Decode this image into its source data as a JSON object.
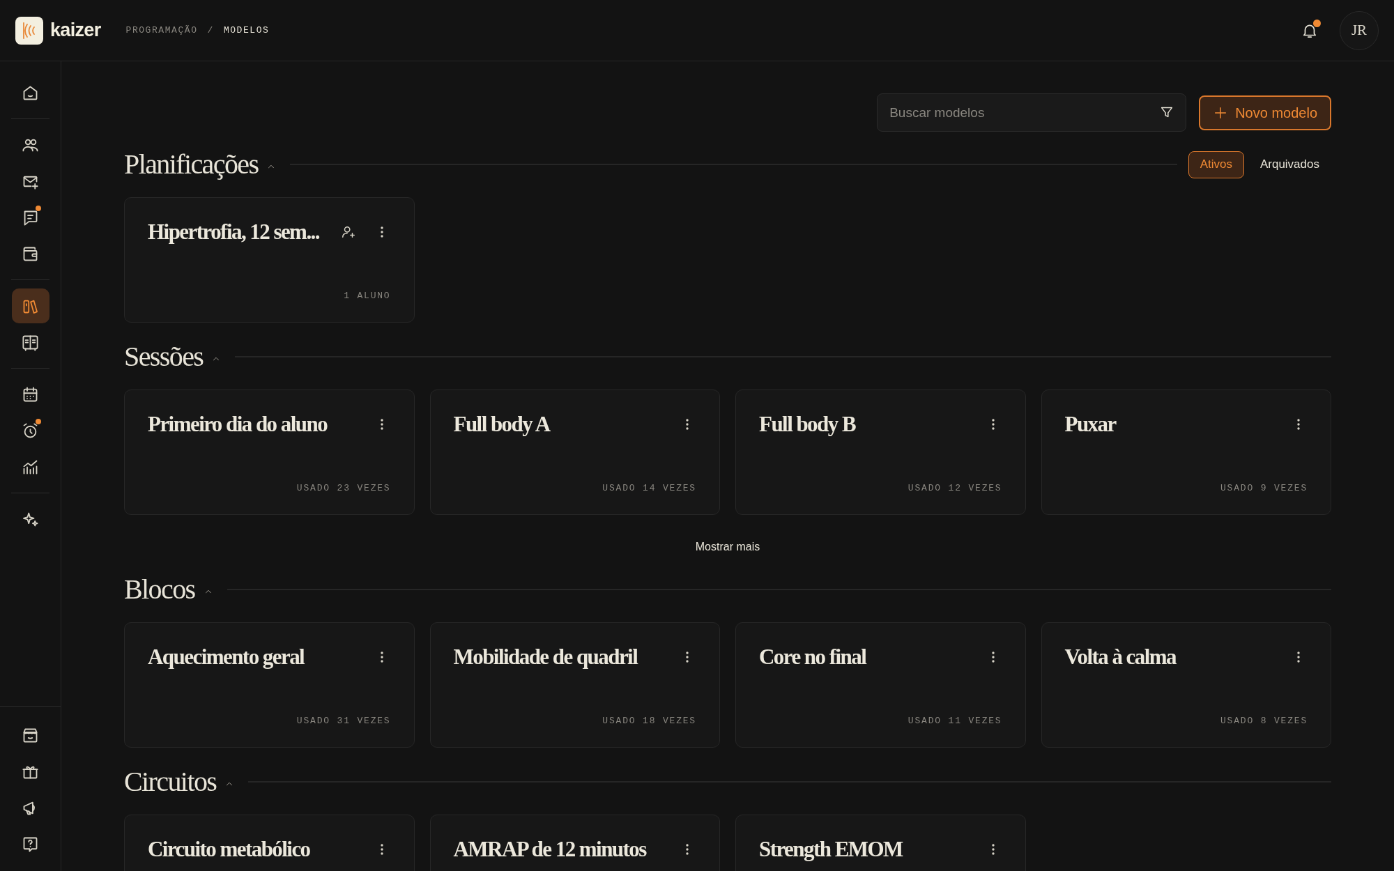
{
  "header": {
    "brand": "kaizer",
    "breadcrumb": [
      {
        "label": "PROGRAMAÇÃO",
        "current": false
      },
      {
        "label": "MODELOS",
        "current": true
      }
    ],
    "breadcrumb_separator": "/",
    "notifications": {
      "unread": true
    },
    "avatar": "JR"
  },
  "sidebar": {
    "groups": [
      [
        {
          "selected": false,
          "badge": false
        }
      ],
      [
        {
          "selected": false,
          "badge": false
        },
        {
          "selected": false,
          "badge": false
        },
        {
          "selected": false,
          "badge": true
        },
        {
          "selected": false,
          "badge": false
        }
      ],
      [
        {
          "selected": true,
          "badge": false
        },
        {
          "selected": false,
          "badge": false
        }
      ],
      [
        {
          "selected": false,
          "badge": false
        },
        {
          "selected": false,
          "badge": true
        },
        {
          "selected": false,
          "badge": false
        }
      ],
      [
        {
          "selected": false,
          "badge": false
        }
      ]
    ],
    "bottom": [
      {
        "selected": false,
        "badge": false
      },
      {
        "selected": false,
        "badge": false
      },
      {
        "selected": false,
        "badge": false
      },
      {
        "selected": false,
        "badge": false
      }
    ]
  },
  "toolbar": {
    "search": {
      "placeholder": "Buscar modelos"
    },
    "new_button": "Novo modelo"
  },
  "sections": [
    {
      "title": "Planificações",
      "expanded": true,
      "filters": [
        {
          "label": "Ativos",
          "selected": true
        },
        {
          "label": "Arquivados",
          "selected": false
        }
      ],
      "cards": [
        {
          "title": "Hipertrofia, 12 sem...",
          "meta": "1 ALUNO",
          "assign": true
        }
      ]
    },
    {
      "title": "Sessões",
      "expanded": true,
      "cards": [
        {
          "title": "Primeiro dia do aluno",
          "meta": "USADO 23 VEZES",
          "assign": false
        },
        {
          "title": "Full body A",
          "meta": "USADO 14 VEZES",
          "assign": false
        },
        {
          "title": "Full body B",
          "meta": "USADO 12 VEZES",
          "assign": false
        },
        {
          "title": "Puxar",
          "meta": "USADO 9 VEZES",
          "assign": false
        }
      ],
      "show_more": "Mostrar mais"
    },
    {
      "title": "Blocos",
      "expanded": true,
      "cards": [
        {
          "title": "Aquecimento geral",
          "meta": "USADO 31 VEZES",
          "assign": false
        },
        {
          "title": "Mobilidade de quadril",
          "meta": "USADO 18 VEZES",
          "assign": false
        },
        {
          "title": "Core no final",
          "meta": "USADO 11 VEZES",
          "assign": false
        },
        {
          "title": "Volta à calma",
          "meta": "USADO 8 VEZES",
          "assign": false
        }
      ]
    },
    {
      "title": "Circuitos",
      "expanded": true,
      "cards": [
        {
          "title": "Circuito metabólico",
          "assign": false
        },
        {
          "title": "AMRAP de 12 minutos",
          "assign": false
        },
        {
          "title": "Strength EMOM",
          "assign": false
        }
      ]
    }
  ]
}
